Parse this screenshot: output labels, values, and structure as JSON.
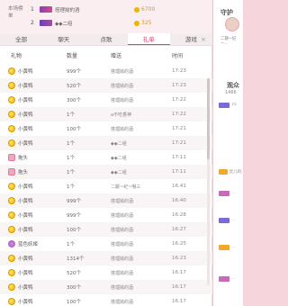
{
  "rank": {
    "title": "本场榜单",
    "rows": [
      {
        "num": "1",
        "name": "搭理拗的酒",
        "score": "6700"
      },
      {
        "num": "2",
        "name": "◆◆二组",
        "score": "325"
      }
    ]
  },
  "guard": {
    "title": "守护",
    "sub": "二颤~纪~…"
  },
  "audience": {
    "title": "观众",
    "count": "1466",
    "items": [
      "75",
      "灵儿的九",
      "…",
      "…",
      "…",
      "…"
    ]
  },
  "tabs": [
    "全部",
    "聊天",
    "点歌",
    "礼单",
    "游戏"
  ],
  "active_tab": "礼单",
  "close_icon": "×",
  "table": {
    "headers": {
      "gift": "礼物",
      "qty": "数量",
      "to": "赠送",
      "time": "时间"
    },
    "rows": [
      {
        "gift": "小黄鸭",
        "icon": "duck",
        "qty": "999个",
        "to": "搭理拗的酒",
        "time": "17:23"
      },
      {
        "gift": "小黄鸭",
        "icon": "duck",
        "qty": "520个",
        "to": "搭理拗的酒",
        "time": "17:23"
      },
      {
        "gift": "小黄鸭",
        "icon": "duck",
        "qty": "300个",
        "to": "搭理拗的酒",
        "time": "17:22"
      },
      {
        "gift": "小黄鸭",
        "icon": "duck",
        "qty": "1个",
        "to": "a不吃香神",
        "time": "17:22"
      },
      {
        "gift": "小黄鸭",
        "icon": "duck",
        "qty": "100个",
        "to": "搭理拗的酒",
        "time": "17:21"
      },
      {
        "gift": "小黄鸭",
        "icon": "duck",
        "qty": "1个",
        "to": "◆◆二组",
        "time": "17:21"
      },
      {
        "gift": "拖头",
        "icon": "slipper",
        "qty": "1个",
        "to": "◆◆二组",
        "time": "17:11"
      },
      {
        "gift": "拖头",
        "icon": "slipper",
        "qty": "1个",
        "to": "◆◆二组",
        "time": "17:11"
      },
      {
        "gift": "小黄鸭",
        "icon": "duck",
        "qty": "1个",
        "to": "二颤~纪~嗷三",
        "time": "16:41"
      },
      {
        "gift": "小黄鸭",
        "icon": "duck",
        "qty": "999个",
        "to": "搭理拗的酒",
        "time": "16:40"
      },
      {
        "gift": "小黄鸭",
        "icon": "duck",
        "qty": "999个",
        "to": "搭理拗的酒",
        "time": "16:28"
      },
      {
        "gift": "小黄鸭",
        "icon": "duck",
        "qty": "100个",
        "to": "搭理拗的酒",
        "time": "16:27"
      },
      {
        "gift": "蓝色妖姬",
        "icon": "flower",
        "qty": "1个",
        "to": "搭理拗的酒",
        "time": "16:25"
      },
      {
        "gift": "小黄鸭",
        "icon": "duck",
        "qty": "1314个",
        "to": "搭理拗的酒",
        "time": "16:23"
      },
      {
        "gift": "小黄鸭",
        "icon": "duck",
        "qty": "520个",
        "to": "搭理拗的酒",
        "time": "16:17"
      },
      {
        "gift": "小黄鸭",
        "icon": "duck",
        "qty": "300个",
        "to": "搭理拗的酒",
        "time": "16:17"
      },
      {
        "gift": "小黄鸭",
        "icon": "duck",
        "qty": "100个",
        "to": "搭理拗的酒",
        "time": "16:17"
      }
    ]
  }
}
